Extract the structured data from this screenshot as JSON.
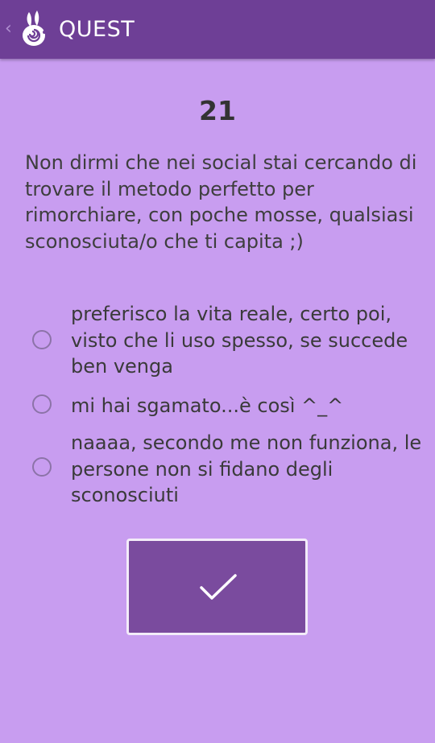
{
  "header": {
    "title": "QUEST",
    "back_icon": "chevron-left-icon",
    "logo_icon": "rabbit-spiral-logo-icon",
    "background": "#6e3f96"
  },
  "question": {
    "number": "21",
    "text": "Non dirmi che nei social stai cercando di trovare il metodo perfetto per rimorchiare, con poche mosse, qualsiasi sconosciuta/o che ti capita ;)"
  },
  "options": [
    {
      "label": "preferisco la vita reale, certo poi, visto che li uso spesso, se succede ben venga",
      "selected": false
    },
    {
      "label": "mi hai sgamato...è così ^_^",
      "selected": false
    },
    {
      "label": "naaaa, secondo me non funziona, le persone non si fidano degli sconosciuti",
      "selected": false
    }
  ],
  "confirm_button": {
    "icon": "checkmark-icon",
    "background": "#7a4b9e"
  },
  "colors": {
    "page_background": "#c89df0",
    "text": "#3a3a3a"
  }
}
